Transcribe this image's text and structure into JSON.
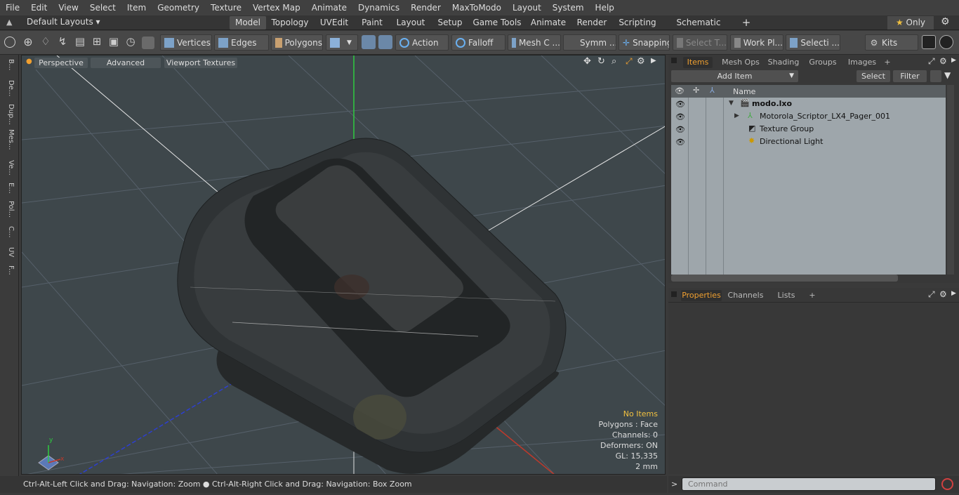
{
  "menu": [
    "File",
    "Edit",
    "View",
    "Select",
    "Item",
    "Geometry",
    "Texture",
    "Vertex Map",
    "Animate",
    "Dynamics",
    "Render",
    "MaxToModo",
    "Layout",
    "System",
    "Help"
  ],
  "layout_selector": "Default Layouts",
  "layout_tabs": [
    "Model",
    "Topology",
    "UVEdit",
    "Paint",
    "Layout",
    "Setup",
    "Game Tools",
    "Animate",
    "Render",
    "Scripting",
    "Schematic Fusion"
  ],
  "add_tab": "+",
  "only_label": "Only",
  "toolbar": {
    "vertices": "Vertices",
    "edges": "Edges",
    "polygons": "Polygons",
    "action": "Action",
    "falloff": "Falloff",
    "mesh": "Mesh C ...",
    "symm": "Symm ...",
    "snapping": "Snapping",
    "select_t": "Select T...",
    "work_pl": "Work Pl...",
    "selecti": "Selecti ...",
    "kits": "Kits"
  },
  "left_tabs": [
    "B...",
    "De...",
    "Dup...",
    "Mes...",
    "Ve...",
    "E...",
    "Pol...",
    "C...",
    "UV",
    "F..."
  ],
  "viewport": {
    "perspective": "Perspective",
    "advanced": "Advanced",
    "viewport_textures": "Viewport Textures",
    "info": {
      "no_items": "No Items",
      "polygons": "Polygons : Face",
      "channels": "Channels: 0",
      "deformers": "Deformers: ON",
      "gl": "GL: 15,335",
      "scale": "2 mm"
    },
    "axis_y": "y",
    "axis_x": "x"
  },
  "items_panel": {
    "tabs": [
      "Items",
      "Mesh Ops",
      "Shading",
      "Groups",
      "Images"
    ],
    "add_item": "Add Item",
    "select": "Select",
    "filter": "Filter",
    "col_name": "Name",
    "tree": [
      {
        "label": "modo.lxo",
        "bold": true
      },
      {
        "label": "Motorola_Scriptor_LX4_Pager_001",
        "bold": false
      },
      {
        "label": "Texture Group",
        "bold": false
      },
      {
        "label": "Directional Light",
        "bold": false
      }
    ]
  },
  "props_panel": {
    "tabs": [
      "Properties",
      "Channels",
      "Lists"
    ]
  },
  "status_text": "Ctrl-Alt-Left Click and Drag: Navigation: Zoom ● Ctrl-Alt-Right Click and Drag: Navigation: Box Zoom",
  "command_placeholder": "Command",
  "colors": {
    "accent": "#f0a030",
    "viewport_bg": "#3e474b",
    "y_axis": "#2ecc40",
    "x_axis": "#c0392b",
    "z_axis": "#2d3fd0"
  }
}
